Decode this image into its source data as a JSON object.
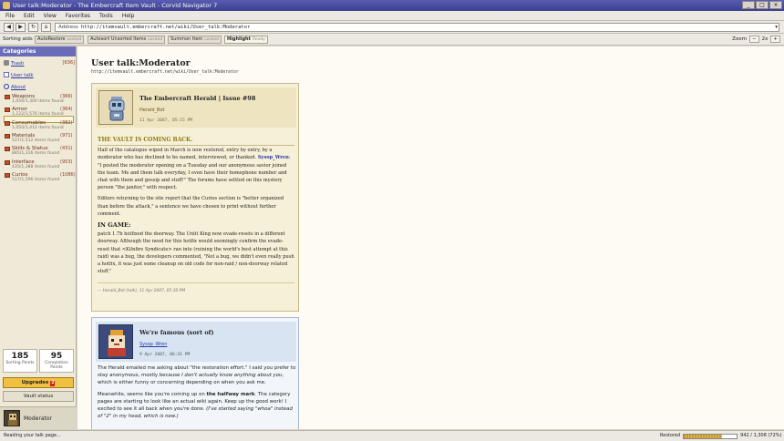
{
  "window": {
    "title": "User talk:Moderator - The Embercraft Item Vault - Corvid Navigator 7",
    "btn_min": "_",
    "btn_max": "□",
    "btn_close": "×"
  },
  "menu": [
    "File",
    "Edit",
    "View",
    "Favorites",
    "Tools",
    "Help"
  ],
  "nav": {
    "back": "◀",
    "forward": "▶",
    "reload": "↻",
    "home": "⌂",
    "address_label": "Address",
    "url": "http://itemvault.embercraft.net/wiki/User_talk:Moderator",
    "drop": "▾"
  },
  "toolbar": {
    "label": "Sorting aids",
    "buttons": [
      {
        "label": "AutoRestore",
        "state": "Locked"
      },
      {
        "label": "Autosort Unsorted Items",
        "state": "Locked"
      },
      {
        "label": "Summon Item",
        "state": "Locked"
      },
      {
        "label": "Highlight",
        "state": "Ready"
      }
    ],
    "zoom_label": "Zoom",
    "zoom_minus": "−",
    "zoom_value": "2x",
    "zoom_plus": "+"
  },
  "sidebar": {
    "title": "Categories",
    "trash": {
      "label": "Trash",
      "count": "[636]"
    },
    "user_talk": {
      "label": "User talk"
    },
    "about": {
      "label": "About"
    },
    "categories": [
      {
        "name": "Weapons",
        "count": "(366)",
        "found": "1,056/1,300 items found"
      },
      {
        "name": "Armor",
        "count": "(364)",
        "found": "1,122/1,576 items found"
      },
      {
        "name": "Consumables",
        "count": "(382)",
        "found": "1,050/1,412 items found"
      },
      {
        "name": "Materials",
        "count": "(971)",
        "found": "537/1,512 items found"
      },
      {
        "name": "Skills & Status",
        "count": "(431)",
        "found": "885/1,316 items found"
      },
      {
        "name": "Interface",
        "count": "(953)",
        "found": "435/1,388 items found"
      },
      {
        "name": "Curios",
        "count": "(1086)",
        "found": "517/1,596 items found"
      }
    ],
    "stats": [
      {
        "value": "185",
        "label": "Sorting Points"
      },
      {
        "value": "95",
        "label": "Completion Points"
      }
    ],
    "upgrades": {
      "label": "Upgrades",
      "badge": "2"
    },
    "vault_status": "Vault status",
    "user": "Moderator"
  },
  "page": {
    "title": "User talk:Moderator",
    "url": "http://itemvault.embercraft.net/wiki/User_talk:Moderator"
  },
  "post1": {
    "title": "The Embercraft Herald | Issue #98",
    "author": "Herald_Bot",
    "date": "11 Apr 2007, 05:15 PM",
    "headline": "THE VAULT IS COMING BACK.",
    "p1a": "Half of the catalogue wiped in March is now restored, entry by entry, by a moderator who has declined to be named, interviewed, or thanked.",
    "p1_name": "Sysop_Wren",
    "p1b": ": \"I posted the moderator opening on a Tuesday and our anonymous savior joined the team. Me and them talk everyday, I even have their homephone number and chat with them and gossip and stuff!\" The forums have settled on this mystery person \"the janitor,\" with respect.",
    "p2": "Editors returning to the site report that the Curios section is \"better organized than before the attack,\" a sentence we have chosen to print without further comment.",
    "section": "IN GAME:",
    "p3": "patch 1.7b hotfixed the doorway. The Unlit King now evade-resets in a different doorway. Although the need for this hotfix would seemingly confirm the evade-reset that <Kilnfire Syndicate> ran into (ruining the world's best attempt at this raid) was a bug, the developers commented, \"Not a bug, we didn't even really push a hotfix, it was just some cleanup on old code for non-raid / non-doorway related stuff.\"",
    "signature": "— Herald_Bot (talk), 11 Apr 2007, 05:30 PM"
  },
  "post2": {
    "title": "We're famous (sort of)",
    "author": "Sysop_Wren",
    "date": "9 Apr 2007, 06:31 PM",
    "p1a": "The Herald emailed me asking about \"the restoration effort.\" I said you prefer to stay anonymous, mostly because ",
    "p1_em": "I don't actually know anything about you",
    "p1b": ", which is either funny or concerning depending on when you ask me.",
    "p2a": "Meanwhile, seems like you're coming up on ",
    "p2_strong": "the halfway mark",
    "p2b": ". The category pages are starting to look like an actual wiki again. Keep up the good work! I excited to see it all back when you're done. ",
    "p2_em": "(I've started saying \"whoa\" instead of \"2\" in my head, which is new.)"
  },
  "status": {
    "left": "Reading your talk page...",
    "restored_label": "Restored",
    "restored_fraction": 0.72,
    "restored_text": "942 / 1,308 (72%)"
  },
  "colors": {
    "titlebar": "#4a4ca0",
    "accent": "#6a6cb8",
    "herald_headline": "#8a7a10"
  }
}
